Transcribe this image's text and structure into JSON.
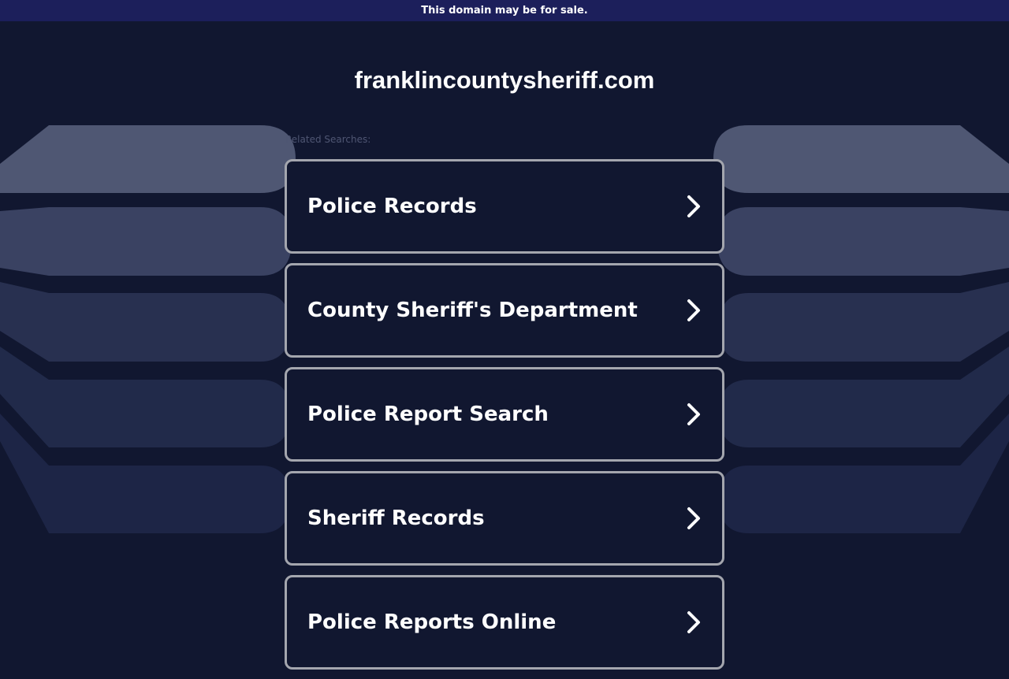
{
  "banner": {
    "text": "This domain may be for sale."
  },
  "domain": {
    "name": "franklincountysheriff.com"
  },
  "related": {
    "label": "Related Searches:"
  },
  "results": [
    {
      "label": "Police Records",
      "icon": "chevron-right-icon"
    },
    {
      "label": "County Sheriff's Department",
      "icon": "chevron-right-icon"
    },
    {
      "label": "Police Report Search",
      "icon": "chevron-right-icon"
    },
    {
      "label": "Sheriff Records",
      "icon": "chevron-right-icon"
    },
    {
      "label": "Police Reports Online",
      "icon": "chevron-right-icon"
    }
  ],
  "colors": {
    "background": "#111730",
    "banner": "#1c1f5b",
    "card_border": "#a4a6ae",
    "text": "#ffffff",
    "muted_text": "#4f5673"
  }
}
